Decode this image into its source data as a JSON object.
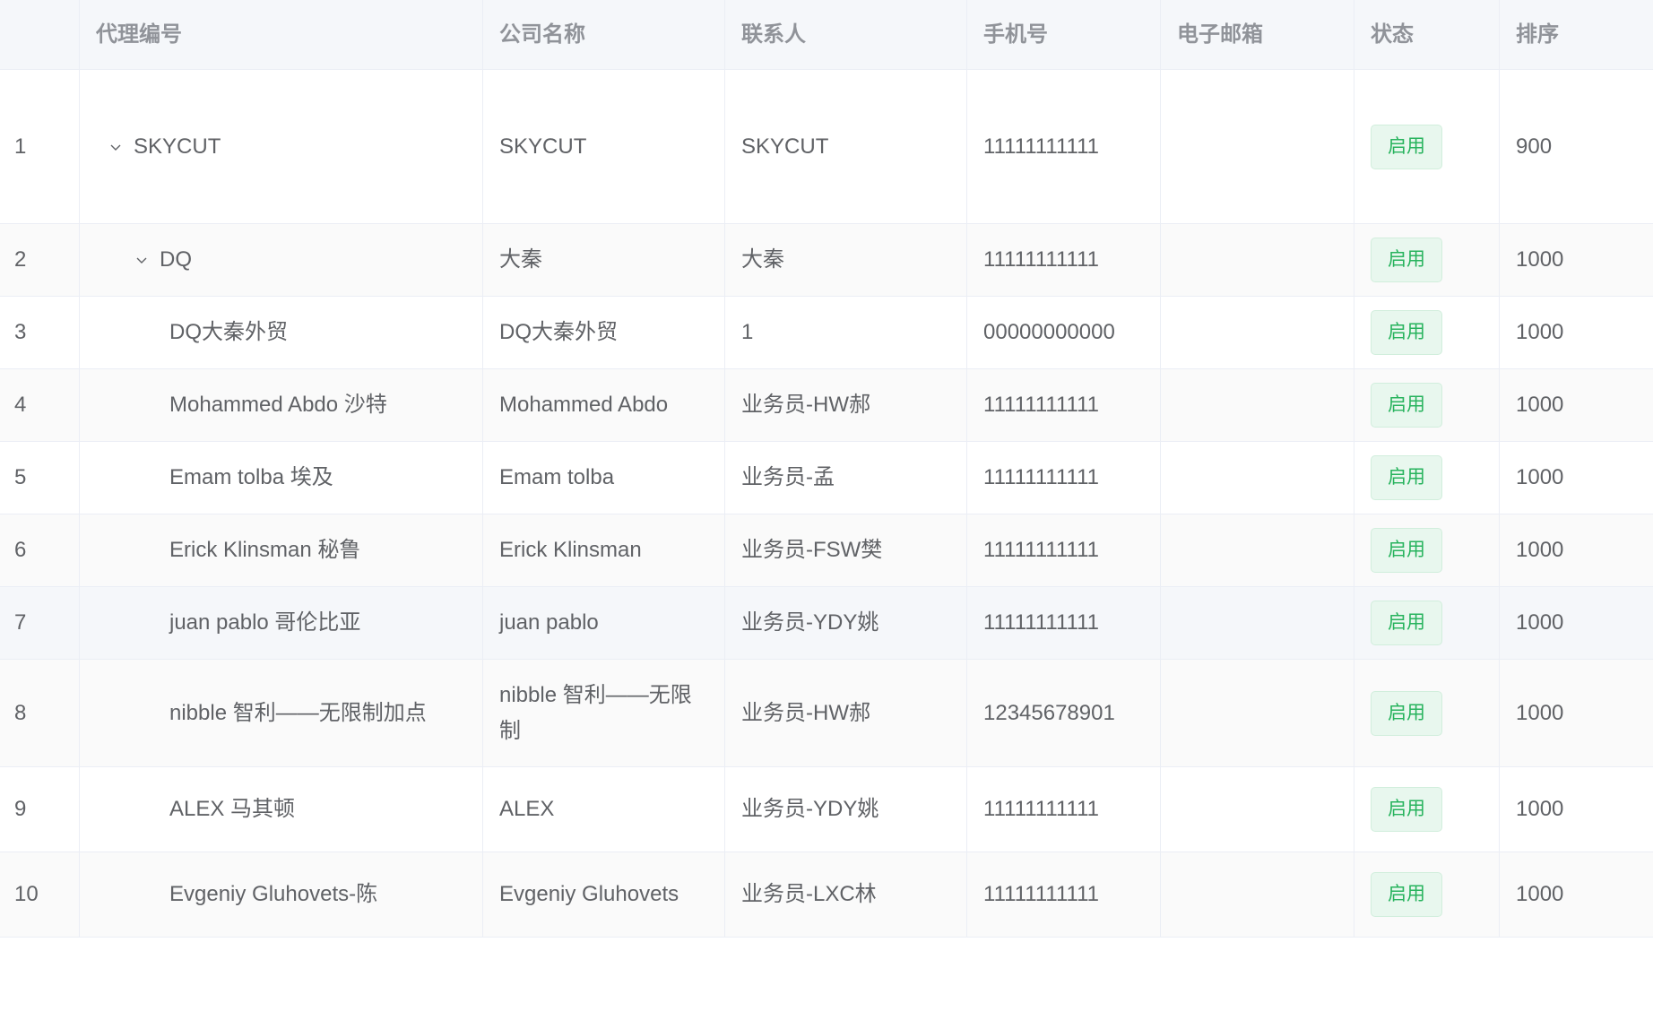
{
  "columns": [
    "",
    "代理编号",
    "公司名称",
    "联系人",
    "手机号",
    "电子邮箱",
    "状态",
    "排序"
  ],
  "rows": [
    {
      "index": "1",
      "code": "SKYCUT",
      "company": "SKYCUT",
      "contact": "SKYCUT",
      "phone": "11111111111",
      "email": "",
      "status": "启用",
      "sort": "900",
      "level": 0,
      "expanded": true
    },
    {
      "index": "2",
      "code": "DQ",
      "company": "大秦",
      "contact": "大秦",
      "phone": "11111111111",
      "email": "",
      "status": "启用",
      "sort": "1000",
      "level": 1,
      "expanded": true
    },
    {
      "index": "3",
      "code": "DQ大秦外贸",
      "company": "DQ大秦外贸",
      "contact": "1",
      "phone": "00000000000",
      "email": "",
      "status": "启用",
      "sort": "1000",
      "level": 2
    },
    {
      "index": "4",
      "code": "Mohammed Abdo 沙特",
      "company": "Mohammed Abdo",
      "contact": "业务员-HW郝",
      "phone": "11111111111",
      "email": "",
      "status": "启用",
      "sort": "1000",
      "level": 2
    },
    {
      "index": "5",
      "code": "Emam tolba 埃及",
      "company": "Emam tolba",
      "contact": "业务员-孟",
      "phone": "11111111111",
      "email": "",
      "status": "启用",
      "sort": "1000",
      "level": 2
    },
    {
      "index": "6",
      "code": "Erick Klinsman 秘鲁",
      "company": "Erick Klinsman",
      "contact": "业务员-FSW樊",
      "phone": "11111111111",
      "email": "",
      "status": "启用",
      "sort": "1000",
      "level": 2
    },
    {
      "index": "7",
      "code": "juan pablo 哥伦比亚",
      "company": "juan pablo",
      "contact": "业务员-YDY姚",
      "phone": "11111111111",
      "email": "",
      "status": "启用",
      "sort": "1000",
      "level": 2
    },
    {
      "index": "8",
      "code": "nibble 智利——无限制加点",
      "company": "nibble 智利——无限制",
      "contact": "业务员-HW郝",
      "phone": "12345678901",
      "email": "",
      "status": "启用",
      "sort": "1000",
      "level": 2
    },
    {
      "index": "9",
      "code": "ALEX 马其顿",
      "company": "ALEX",
      "contact": "业务员-YDY姚",
      "phone": "11111111111",
      "email": "",
      "status": "启用",
      "sort": "1000",
      "level": 2
    },
    {
      "index": "10",
      "code": "Evgeniy Gluhovets-陈",
      "company": "Evgeniy Gluhovets",
      "contact": "业务员-LXC林",
      "phone": "11111111111",
      "email": "",
      "status": "启用",
      "sort": "1000",
      "level": 2
    }
  ],
  "icons": {
    "expand": "chevron-down-icon"
  },
  "colors": {
    "status_text": "#27b35d",
    "status_bg": "#e8f7ee",
    "header_bg": "#f5f7fa"
  }
}
